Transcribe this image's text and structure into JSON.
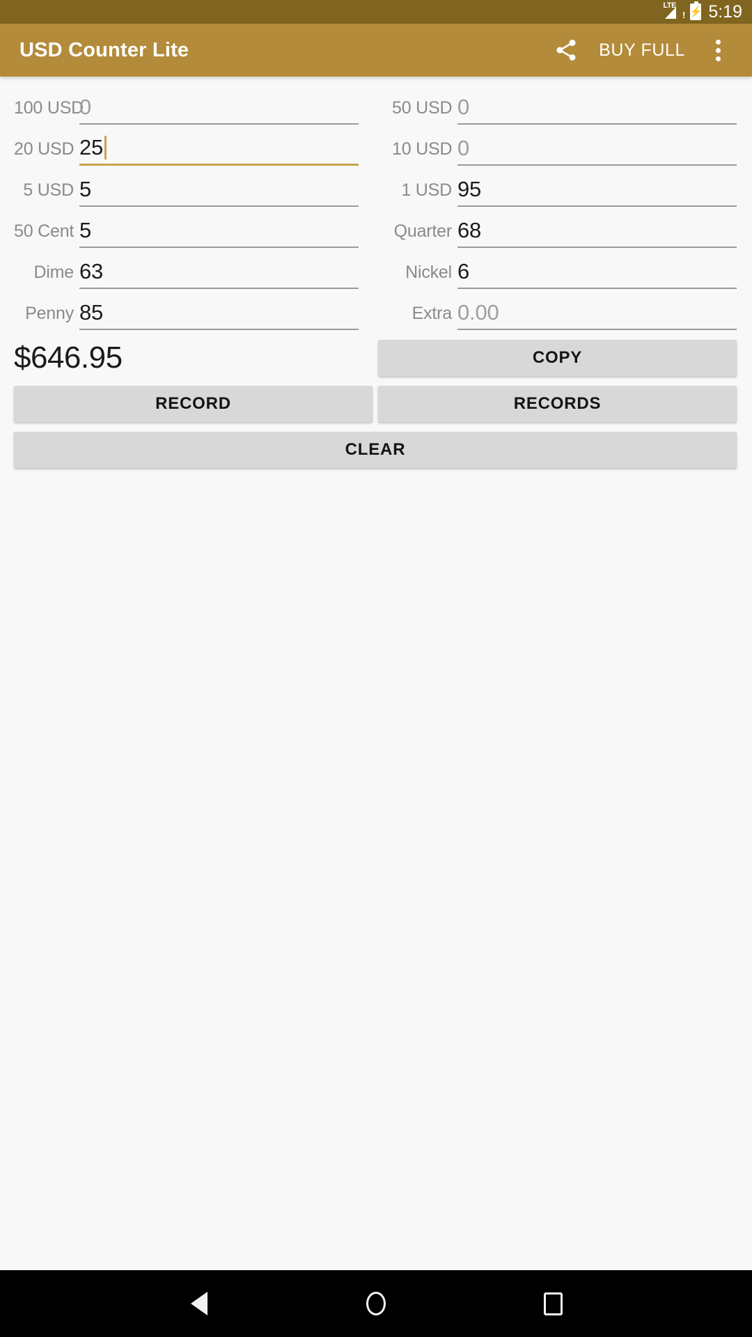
{
  "status_bar": {
    "network_label": "LTE",
    "network_alert": "!",
    "time": "5:19",
    "signal_icon": "signal-lte-icon",
    "battery_icon": "battery-charging-icon"
  },
  "app_bar": {
    "title": "USD Counter Lite",
    "share_icon": "share-icon",
    "buy_full_label": "BUY FULL",
    "overflow_icon": "overflow-menu-icon",
    "background_color": "#b38b3a",
    "status_color": "#7f651f"
  },
  "fields": [
    {
      "label": "100 USD",
      "value": "0",
      "is_hint": true,
      "focused": false
    },
    {
      "label": "50 USD",
      "value": "0",
      "is_hint": true,
      "focused": false
    },
    {
      "label": "20 USD",
      "value": "25",
      "is_hint": false,
      "focused": true
    },
    {
      "label": "10 USD",
      "value": "0",
      "is_hint": true,
      "focused": false
    },
    {
      "label": "5 USD",
      "value": "5",
      "is_hint": false,
      "focused": false
    },
    {
      "label": "1 USD",
      "value": "95",
      "is_hint": false,
      "focused": false
    },
    {
      "label": "50 Cent",
      "value": "5",
      "is_hint": false,
      "focused": false
    },
    {
      "label": "Quarter",
      "value": "68",
      "is_hint": false,
      "focused": false
    },
    {
      "label": "Dime",
      "value": "63",
      "is_hint": false,
      "focused": false
    },
    {
      "label": "Nickel",
      "value": "6",
      "is_hint": false,
      "focused": false
    },
    {
      "label": "Penny",
      "value": "85",
      "is_hint": false,
      "focused": false
    },
    {
      "label": "Extra",
      "value": "0.00",
      "is_hint": true,
      "focused": false
    }
  ],
  "total": {
    "amount": "$646.95"
  },
  "buttons": {
    "copy": "COPY",
    "record": "RECORD",
    "records": "RECORDS",
    "clear": "CLEAR",
    "background_color": "#d8d8d8"
  },
  "nav_bar": {
    "back_icon": "nav-back-icon",
    "home_icon": "nav-home-icon",
    "recents_icon": "nav-recents-icon"
  },
  "accent_color": "#c8a44c"
}
